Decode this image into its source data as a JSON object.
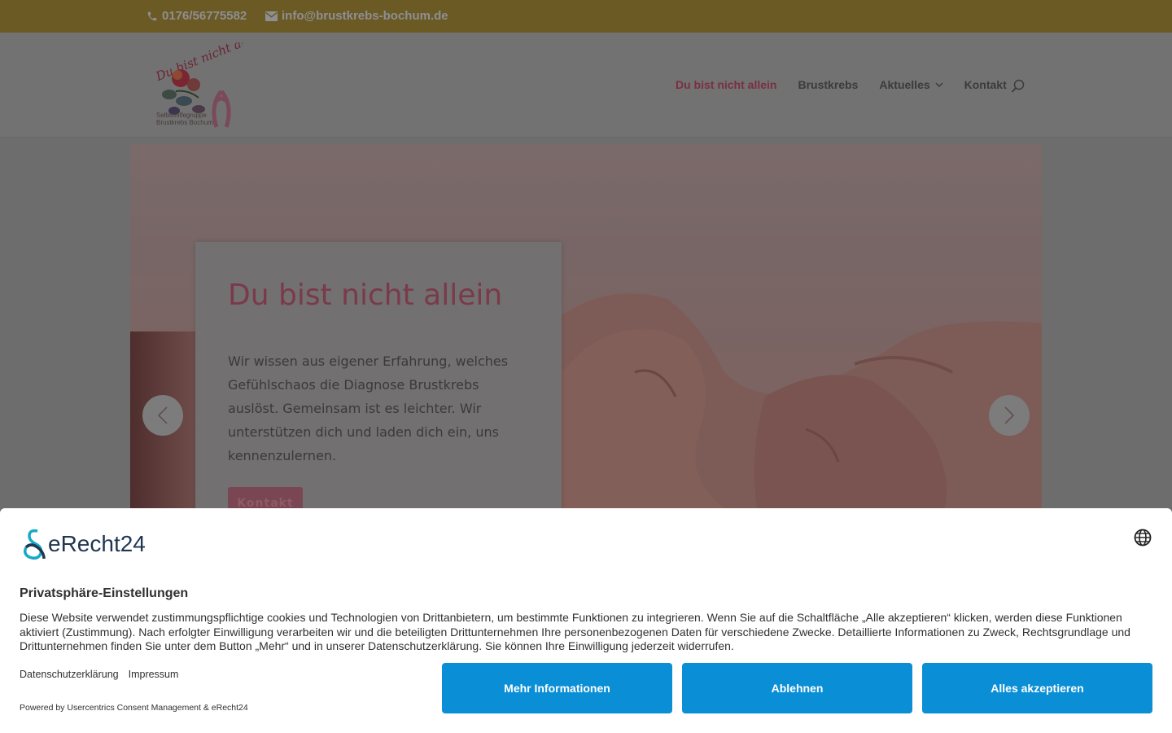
{
  "topbar": {
    "phone": "0176/56775582",
    "email": "info@brustkrebs-bochum.de"
  },
  "logo": {
    "script_text": "Du bist nicht allein!",
    "caption_line1": "Selbsthilfegruppe",
    "caption_line2": "Brustkrebs Bochum"
  },
  "nav": {
    "items": [
      {
        "label": "Du bist nicht allein",
        "active": true
      },
      {
        "label": "Brustkrebs",
        "active": false
      },
      {
        "label": "Aktuelles",
        "active": false,
        "has_dropdown": true
      },
      {
        "label": "Kontakt",
        "active": false
      }
    ]
  },
  "hero": {
    "title": "Du bist nicht allein",
    "text": "Wir wissen aus eigener Erfahrung, welches Gefühlschaos die Diagnose Brustkrebs auslöst. Gemeinsam ist es leichter. Wir unterstützen dich und laden dich ein, uns kennenzulernen.",
    "button": "Kontakt"
  },
  "consent": {
    "brand": "eRecht24",
    "title": "Privatsphäre-Einstellungen",
    "text": "Diese Website verwendet zustimmungspflichtige cookies und Technologien von Drittanbietern, um bestimmte Funktionen zu integrieren. Wenn Sie auf die Schaltfläche „Alle akzeptieren“ klicken, werden diese Funktionen aktiviert (Zustimmung). Nach erfolgter Einwilligung verarbeiten wir und die beteiligten Drittunternehmen Ihre personenbezogenen Daten für verschiedene Zwecke. Detaillierte Informationen zu Zweck, Rechtsgrundlage und Drittunternehmen finden Sie unter dem Button „Mehr“ und in unserer Datenschutzerklärung. Sie können Ihre Einwilligung jederzeit widerrufen.",
    "link_privacy": "Datenschutzerklärung",
    "link_imprint": "Impressum",
    "powered_by": "Powered by Usercentrics Consent Management & eRecht24",
    "btn_more": "Mehr Informationen",
    "btn_decline": "Ablehnen",
    "btn_accept": "Alles akzeptieren"
  },
  "colors": {
    "topbar_bg": "#6b5a23",
    "brand_pink": "#c0506e",
    "consent_button": "#0a8fd6",
    "consent_brand": "#1e3650"
  },
  "icons": [
    "phone-icon",
    "mail-icon",
    "search-icon",
    "chevron-down-icon",
    "arrow-left-icon",
    "arrow-right-icon",
    "globe-icon"
  ]
}
